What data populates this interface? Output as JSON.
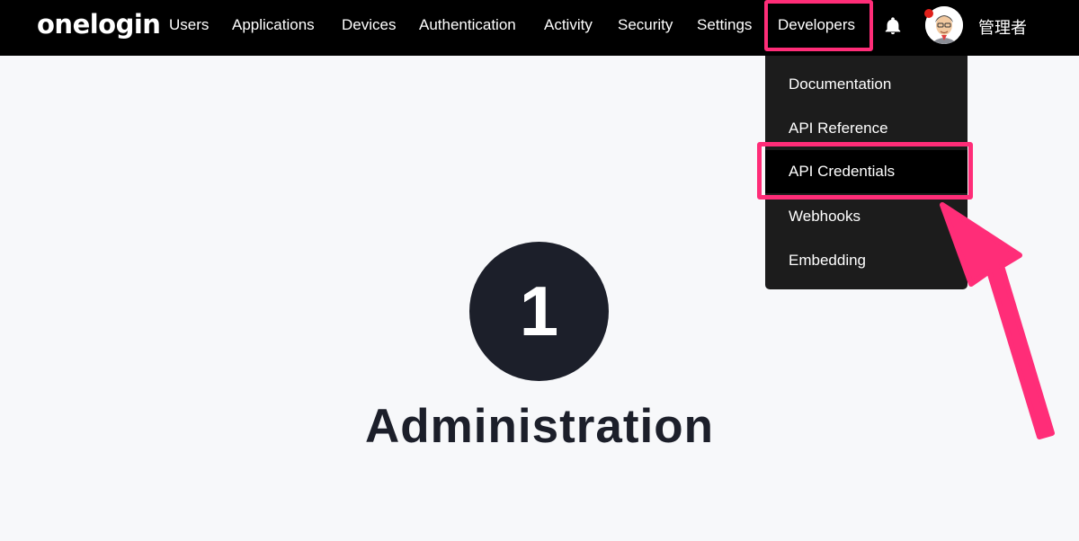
{
  "header": {
    "logo": "onelogin",
    "nav": [
      {
        "label": "Users"
      },
      {
        "label": "Applications"
      },
      {
        "label": "Devices"
      },
      {
        "label": "Authentication"
      },
      {
        "label": "Activity"
      },
      {
        "label": "Security"
      },
      {
        "label": "Settings"
      },
      {
        "label": "Developers"
      }
    ],
    "username": "管理者"
  },
  "developers_menu": {
    "items": [
      {
        "label": "Documentation"
      },
      {
        "label": "API Reference"
      },
      {
        "label": "API Credentials"
      },
      {
        "label": "Webhooks"
      },
      {
        "label": "Embedding"
      }
    ]
  },
  "main": {
    "step_number": "1",
    "step_title": "Administration"
  },
  "colors": {
    "highlight": "#ff2d78",
    "header_bg": "#000000",
    "menu_bg": "#1c1c1c",
    "circle": "#1c1f2a"
  },
  "icons": [
    "bell-icon",
    "user-avatar",
    "pointer-arrow"
  ]
}
